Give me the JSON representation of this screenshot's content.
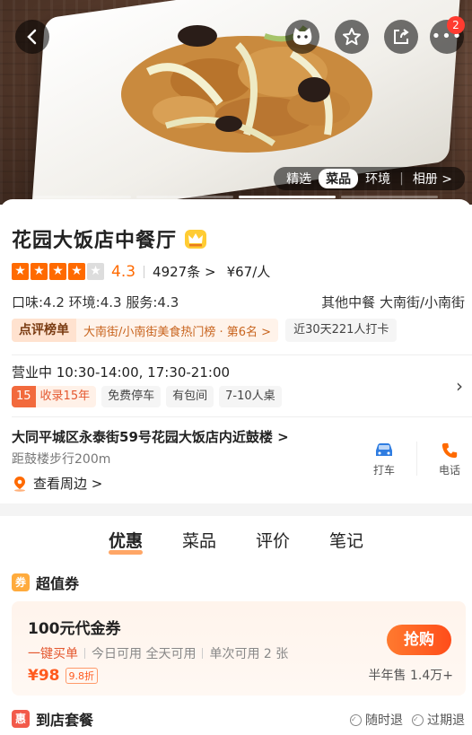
{
  "header": {
    "gallery_tabs": [
      "精选",
      "菜品",
      "环境",
      "相册 >"
    ],
    "active_gallery_tab": "菜品",
    "notification_count": "2"
  },
  "restaurant": {
    "name": "花园大饭店中餐厅",
    "rating": "4.3",
    "rating_value": 4.3,
    "reviews": "4927条 >",
    "price": "¥67/人",
    "sub_scores": "口味:4.2  环境:4.3  服务:4.3",
    "category_area": "其他中餐  大南街/小南街",
    "rank_tag": "点评榜单",
    "rank_text": "大南街/小南街美食热门榜 · 第6名 >",
    "checkins": "近30天221人打卡",
    "hours": "营业中 10:30-14:00, 17:30-21:00",
    "years_num": "15",
    "years_label": "收录15年",
    "tags": [
      "免费停车",
      "有包间",
      "7-10人桌"
    ],
    "address": "大同平城区永泰街59号花园大饭店内近鼓楼 >",
    "distance": "距鼓楼步行200m",
    "nearby": "查看周边 >",
    "actions": {
      "taxi": "打车",
      "phone": "电话"
    }
  },
  "main_tabs": [
    "优惠",
    "菜品",
    "评价",
    "笔记"
  ],
  "active_main_tab": "优惠",
  "deals": {
    "section_icon": "券",
    "section_title": "超值券",
    "coupon": {
      "title": "100元代金券",
      "buy_hint": "一键买单",
      "info": [
        "今日可用 全天可用",
        "单次可用 2 张"
      ],
      "price": "¥98",
      "discount": "9.8折",
      "button": "抢购",
      "sold": "半年售 1.4万+"
    }
  },
  "packages": {
    "section_icon": "惠",
    "section_title": "到店套餐",
    "refund_any": "随时退",
    "refund_expired": "过期退"
  },
  "colors": {
    "accent": "#ff6a00",
    "buy_button": "#ff5a1f",
    "badge": "#ff3b30",
    "taxi_icon": "#2f7de1"
  }
}
